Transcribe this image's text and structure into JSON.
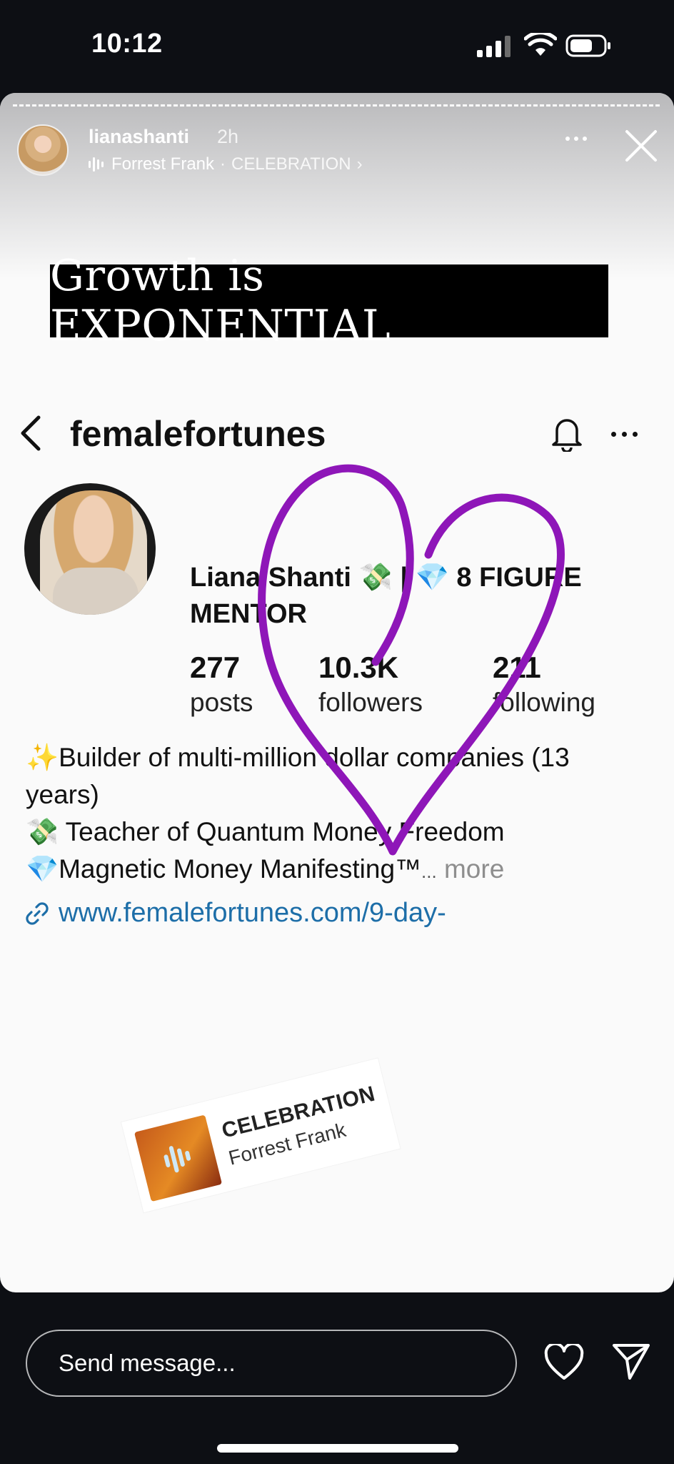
{
  "status_bar": {
    "time": "10:12"
  },
  "story": {
    "username": "lianashanti",
    "time_ago": "2h",
    "music_artist": "Forrest Frank",
    "music_separator": "·",
    "music_title": "CELEBRATION",
    "music_chevron": "›",
    "headline": "Growth is EXPONENTIAL",
    "drawing_color": "#8e16b8"
  },
  "profile": {
    "handle": "femalefortunes",
    "name_line1": "Liana Shanti 💸 | 💎 8 FIGURE",
    "name_line2": "MENTOR",
    "posts_count": "277",
    "posts_label": "posts",
    "followers_count": "10.3K",
    "followers_label": "followers",
    "following_count": "211",
    "following_label": "following",
    "bio_line1": "✨Builder of multi-million dollar companies (13",
    "bio_line2": "years)",
    "bio_line3": "💸 Teacher of Quantum Money Freedom",
    "bio_line4": "💎Magnetic Money Manifesting™",
    "bio_ellipsis": "...",
    "bio_more": " more",
    "link": "www.femalefortunes.com/9-day-"
  },
  "sticker": {
    "title": "CELEBRATION",
    "artist": "Forrest Frank"
  },
  "footer": {
    "message_placeholder": "Send message..."
  },
  "icons": {
    "back": "chevron-left-icon",
    "bell": "bell-icon",
    "close": "close-icon",
    "like": "heart-icon",
    "send": "send-icon",
    "link": "link-icon"
  }
}
